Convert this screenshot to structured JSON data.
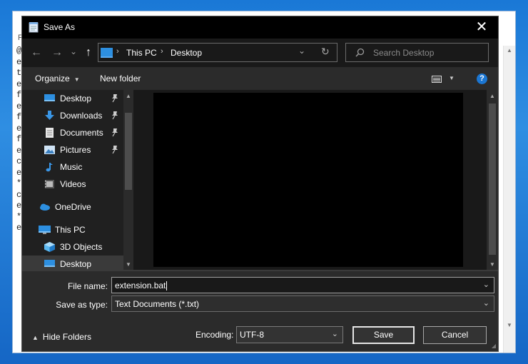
{
  "background_window": {
    "menu_char": "F",
    "text_lines": [
      "@",
      "e",
      "t",
      "e",
      "f",
      "e",
      "f",
      "e",
      "f",
      "e",
      "c",
      "e",
      "*",
      "c",
      "e",
      "*",
      "e"
    ]
  },
  "dialog": {
    "title": "Save As",
    "close_symbol": "✕",
    "nav": {
      "back_symbol": "←",
      "forward_symbol": "→",
      "recent_symbol": "⌄",
      "up_symbol": "↑"
    },
    "address": {
      "crumbs": [
        "This PC",
        "Desktop"
      ],
      "separator": "›",
      "dropdown_symbol": "⌄",
      "refresh_symbol": "↻"
    },
    "search": {
      "placeholder": "Search Desktop"
    },
    "toolbar": {
      "organize_label": "Organize",
      "organize_caret": "▼",
      "new_folder_label": "New folder",
      "view_caret": "▼",
      "help_label": "?"
    },
    "nav_pane": {
      "scroll_up": "▲",
      "scroll_down": "▼",
      "items": [
        {
          "label": "Desktop",
          "icon": "desktop-icon",
          "pinned": true
        },
        {
          "label": "Downloads",
          "icon": "download-icon",
          "pinned": true
        },
        {
          "label": "Documents",
          "icon": "documents-icon",
          "pinned": true
        },
        {
          "label": "Pictures",
          "icon": "pictures-icon",
          "pinned": true
        },
        {
          "label": "Music",
          "icon": "music-icon",
          "pinned": false
        },
        {
          "label": "Videos",
          "icon": "videos-icon",
          "pinned": false
        },
        {
          "label": "OneDrive",
          "icon": "onedrive-icon",
          "pinned": false
        },
        {
          "label": "This PC",
          "icon": "this-pc-icon",
          "pinned": false
        },
        {
          "label": "3D Objects",
          "icon": "3d-objects-icon",
          "pinned": false
        },
        {
          "label": "Desktop",
          "icon": "desktop-icon",
          "pinned": false,
          "selected": true
        }
      ]
    },
    "main_scroll": {
      "up": "▲",
      "down": "▼"
    },
    "file_name": {
      "label": "File name:",
      "value": "extension.bat",
      "caret": "⌄"
    },
    "save_as_type": {
      "label": "Save as type:",
      "value": "Text Documents (*.txt)",
      "caret": "⌄"
    },
    "hide_folders": {
      "label": "Hide Folders",
      "chevron": "▲"
    },
    "encoding": {
      "label": "Encoding:",
      "value": "UTF-8",
      "caret": "⌄"
    },
    "buttons": {
      "save": "Save",
      "cancel": "Cancel"
    },
    "grip_symbol": "◢"
  },
  "colors": {
    "dialog_bg": "#2b2b2b",
    "titlebar_bg": "#000000",
    "accent": "#1b76d2",
    "desktop_bg": "#1a78d6"
  }
}
